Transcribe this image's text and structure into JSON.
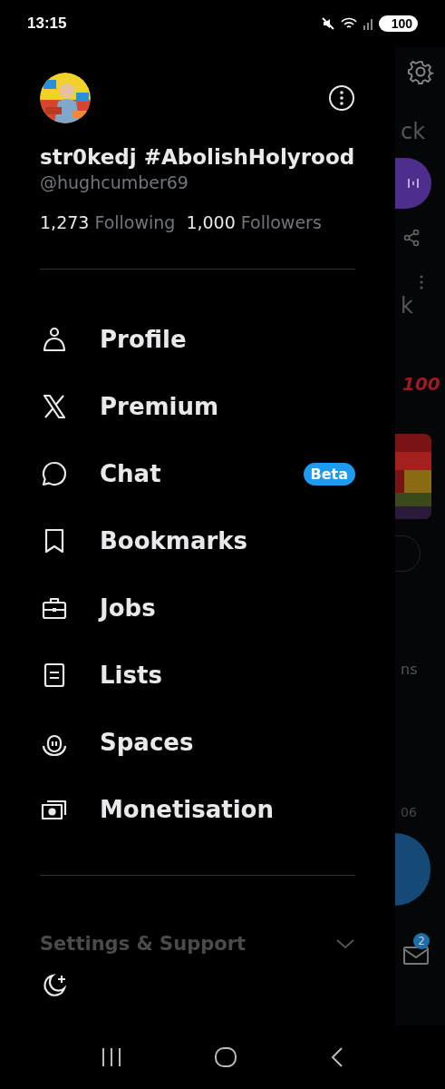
{
  "status_bar": {
    "time": "13:15",
    "battery": "100"
  },
  "profile": {
    "name": "str0kedj #AbolishHolyrood",
    "handle": "@hughcumber69",
    "following_count": "1,273",
    "following_label": "Following",
    "followers_count": "1,000",
    "followers_label": "Followers"
  },
  "menu": [
    {
      "label": "Profile"
    },
    {
      "label": "Premium"
    },
    {
      "label": "Chat",
      "badge": "Beta"
    },
    {
      "label": "Bookmarks"
    },
    {
      "label": "Jobs"
    },
    {
      "label": "Lists"
    },
    {
      "label": "Spaces"
    },
    {
      "label": "Monetisation"
    }
  ],
  "settings_section": {
    "label": "Settings & Support",
    "expanded": false
  },
  "background_timeline": {
    "texts": [
      "ck",
      "k"
    ],
    "emoji_text": "100",
    "text_3": "ns",
    "text_4": "06",
    "messages_badge": "2"
  }
}
